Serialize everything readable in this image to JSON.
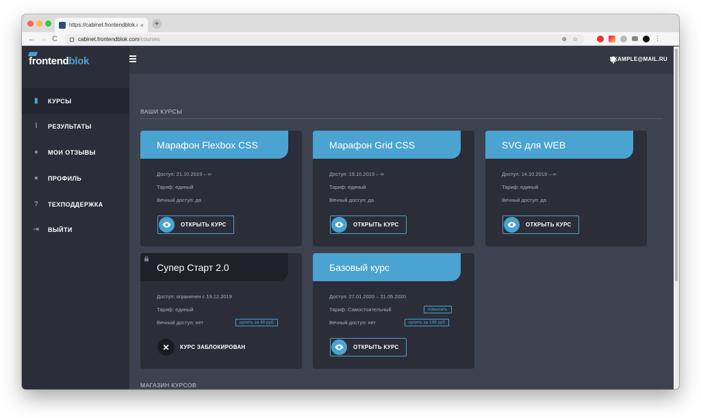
{
  "browser": {
    "tab_title": "https://cabinet.frontendblok.com",
    "tab_close": "×",
    "new_tab": "+",
    "url_host": "cabinet.frontendblok.com",
    "url_path": "/courses",
    "back": "←",
    "forward": "→",
    "reload": "C",
    "zoom": "⊕",
    "star": "☆",
    "menu": "⋮"
  },
  "logo": {
    "main": "frontend",
    "accent": "blok"
  },
  "sidebar": {
    "items": [
      {
        "label": "КУРСЫ",
        "icon": "book-icon",
        "glyph": "▮",
        "active": true
      },
      {
        "label": "РЕЗУЛЬТАТЫ",
        "icon": "chart-icon",
        "glyph": "⌇"
      },
      {
        "label": "МОИ ОТЗЫВЫ",
        "icon": "comment-icon",
        "glyph": "●"
      },
      {
        "label": "ПРОФИЛЬ",
        "icon": "user-icon",
        "glyph": "●"
      },
      {
        "label": "ТЕХПОДДЕРЖКА",
        "icon": "question-icon",
        "glyph": "?"
      },
      {
        "label": "ВЫЙТИ",
        "icon": "sign-out-icon",
        "glyph": "⇥"
      }
    ]
  },
  "header": {
    "email": "EXAMPLE@MAIL.RU"
  },
  "sections": {
    "my_courses": "ВАШИ КУРСЫ",
    "shop": "МАГАЗИН КУРСОВ"
  },
  "courses": [
    {
      "title": "Марафон Flexbox CSS",
      "access": "Доступ: 21.10.2019 – ∞",
      "tariff": "Тариф: единый",
      "forever": "Вечный доступ: да",
      "button": "ОТКРЫТЬ КУРС"
    },
    {
      "title": "Марафон Grid CSS",
      "access": "Доступ: 19.10.2019 – ∞",
      "tariff": "Тариф: единый",
      "forever": "Вечный доступ: да",
      "button": "ОТКРЫТЬ КУРС"
    },
    {
      "title": "SVG для WEB",
      "access": "Доступ: 14.10.2019 – ∞",
      "tariff": "Тариф: единый",
      "forever": "Вечный доступ: да",
      "button": "ОТКРЫТЬ КУРС"
    },
    {
      "title": "Супер Старт 2.0",
      "access": "Доступ: ограничен с 19.12.2019",
      "tariff": "Тариф: единый",
      "forever": "Вечный доступ: нет",
      "buy_tag": "купить за 49 руб",
      "button": "КУРС ЗАБЛОКИРОВАН",
      "blocked_glyph": "✕",
      "locked": true
    },
    {
      "title": "Базовый курс",
      "access": "Доступ: 27.01.2020 – 21.05.2020",
      "tariff": "Тариф: Самостоятельный",
      "upgrade_tag": "повысить",
      "forever": "Вечный доступ: нет",
      "buy_tag": "купить за 199 руб",
      "button": "ОТКРЫТЬ КУРС"
    }
  ],
  "colors": {
    "accent": "#4aa3d0",
    "sidebar": "#2b2e38",
    "content": "#3d4250",
    "card": "#2b2e38"
  }
}
